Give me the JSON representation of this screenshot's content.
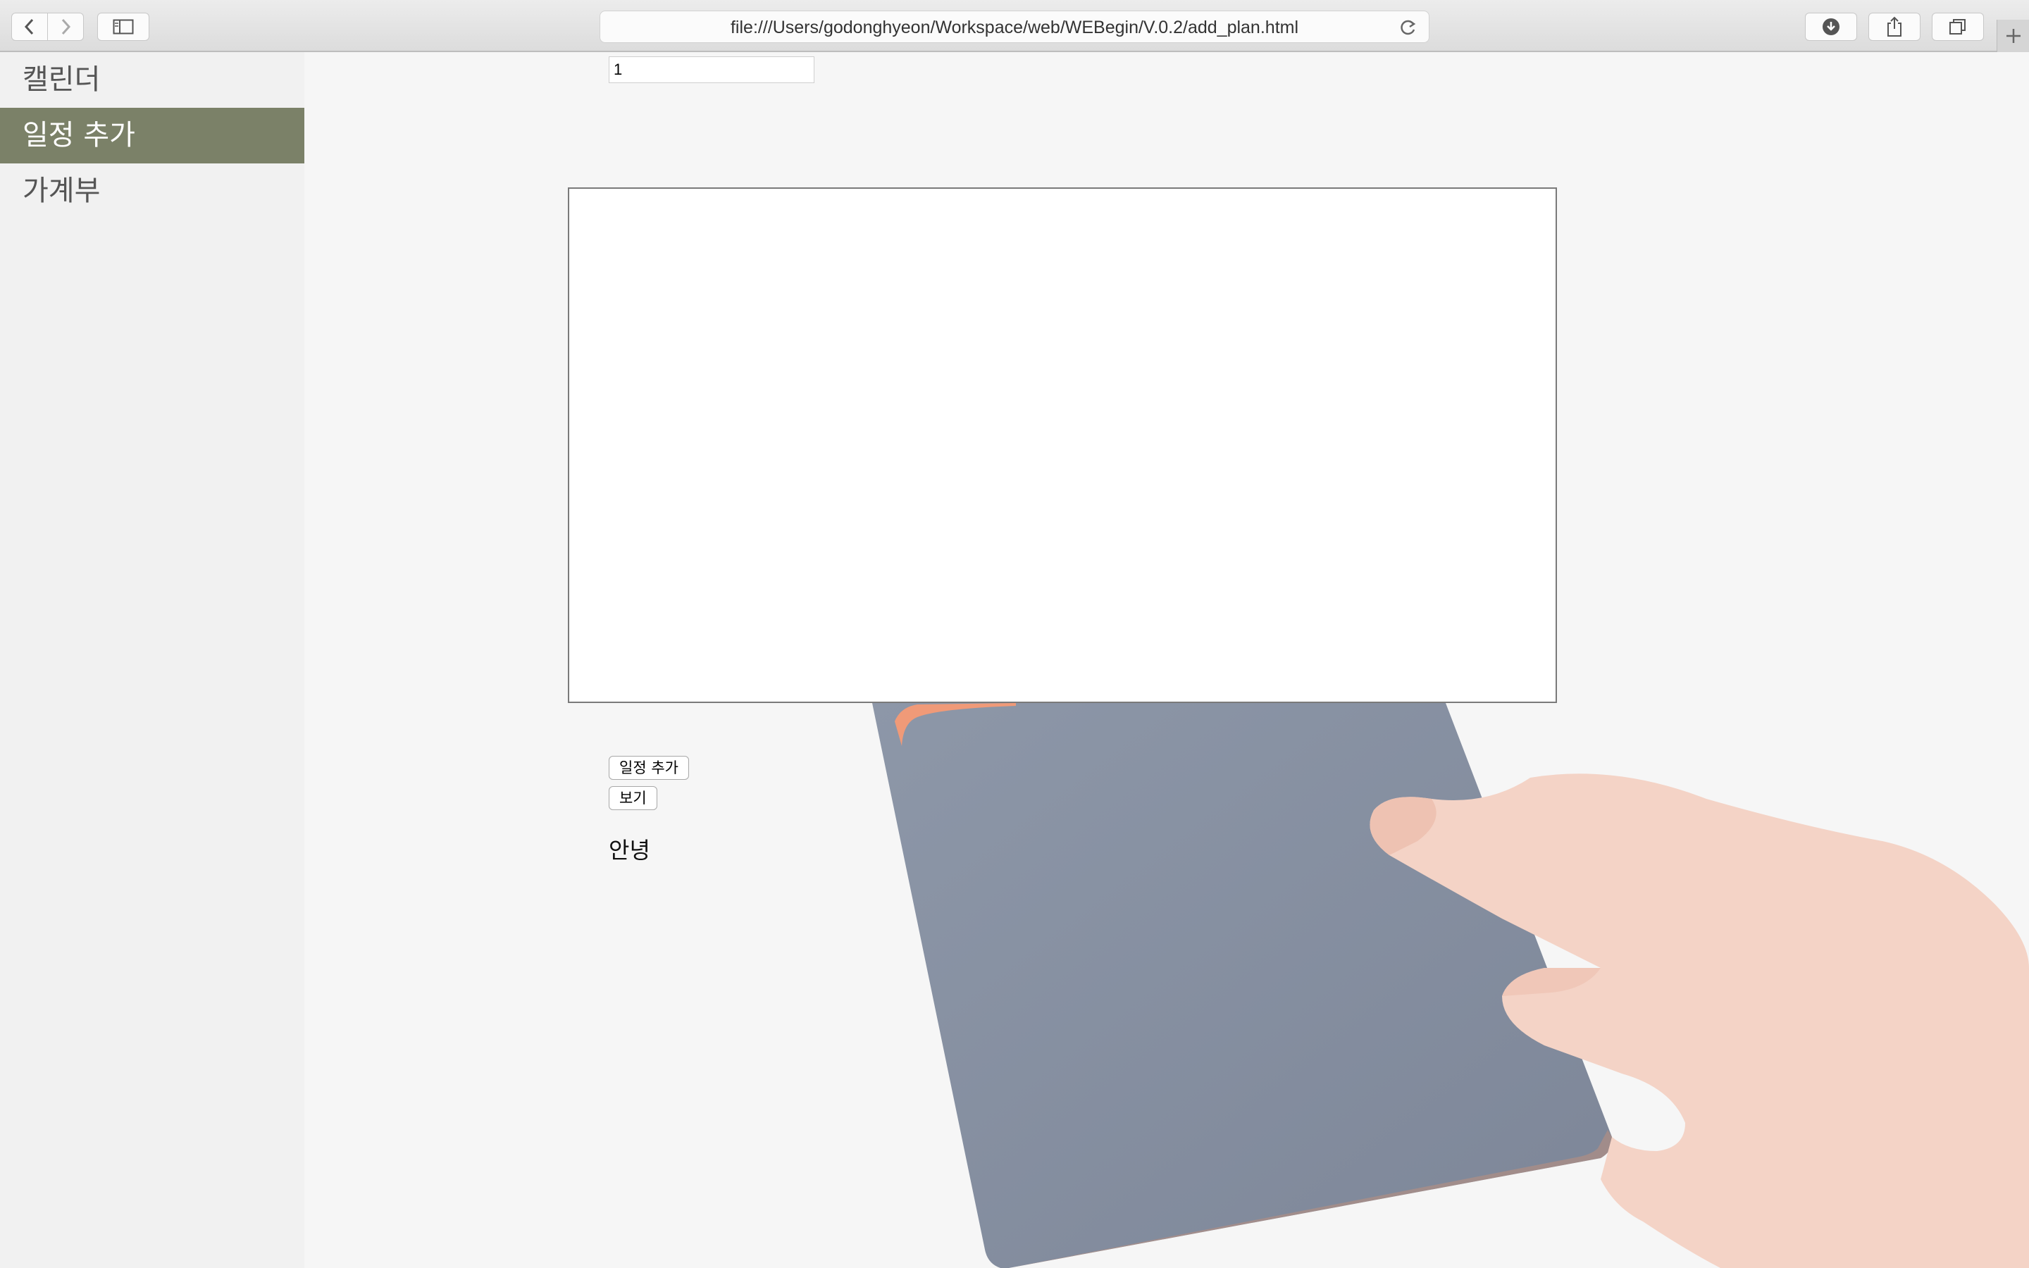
{
  "browser": {
    "url": "file:///Users/godonghyeon/Workspace/web/WEBegin/V.0.2/add_plan.html",
    "icons": {
      "back": "chevron-left-icon",
      "forward": "chevron-right-icon",
      "sidebar": "sidebar-icon",
      "reload": "reload-icon",
      "downloads": "download-icon",
      "share": "share-icon",
      "tabs": "tabs-icon",
      "new_tab": "plus-icon"
    }
  },
  "sidebar": {
    "items": [
      {
        "label": "캘린더"
      },
      {
        "label": "일정 추가"
      },
      {
        "label": "가계부"
      }
    ],
    "active_color": "#7b8168"
  },
  "form": {
    "number_value": "1",
    "textarea_value": "",
    "add_button": "일정 추가",
    "view_button": "보기",
    "greeting": "안녕"
  }
}
